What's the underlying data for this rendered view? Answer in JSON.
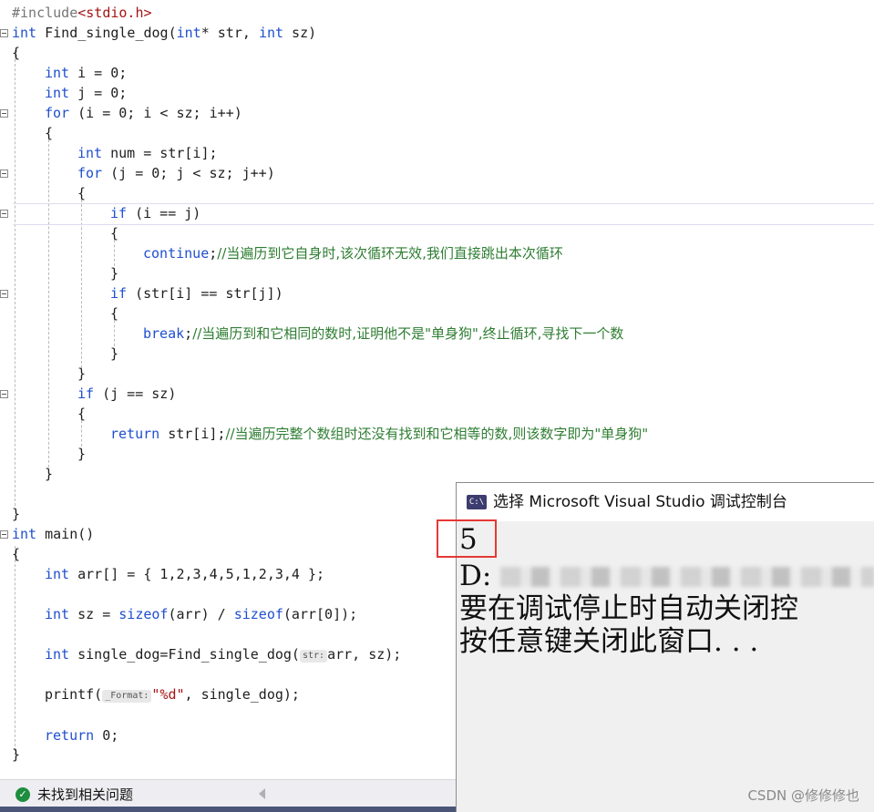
{
  "code": {
    "include_directive": "#include",
    "include_header": "<stdio.h>",
    "kw_int": "int",
    "kw_for": "for",
    "kw_if": "if",
    "kw_continue": "continue",
    "kw_break": "break",
    "kw_return": "return",
    "kw_sizeof": "sizeof",
    "l2_rest": " Find_single_dog(",
    "l2_rest2": "* str, ",
    "l2_rest3": " sz)",
    "brace_open": "{",
    "brace_close": "}",
    "l4_rest": " i = 0;",
    "l5_rest": " j = 0;",
    "l6_rest": " (i = 0; i < sz; i++)",
    "l8_rest": " num = str[i];",
    "l9_rest": " (j = 0; j < sz; j++)",
    "l11_rest": " (i == j)",
    "l13_comment": "//当遍历到它自身时,该次循环无效,我们直接跳出本次循环",
    "l15_rest": " (str[i] == str[j])",
    "l17_comment": "//当遍历到和它相同的数时,证明他不是\"单身狗\",终止循环,寻找下一个数",
    "l20_rest": " (j == sz)",
    "l22_rest": " str[i];",
    "l22_comment": "//当遍历完整个数组时还没有找到和它相等的数,则该数字即为\"单身狗\"",
    "main_rest": " main()",
    "arr_rest": " arr[] = { 1,2,3,4,5,1,2,3,4 };",
    "sz_rest": " sz = ",
    "sz_rest2": "(arr) / ",
    "sz_rest3": "(arr[0]);",
    "sd_rest": " single_dog=Find_single_dog(",
    "sd_hint": "str:",
    "sd_rest2": "arr, sz);",
    "printf_open": "printf(",
    "printf_hint": "_Format:",
    "printf_str": "\"%d\"",
    "printf_rest": ", single_dog);",
    "return_rest": " 0;"
  },
  "console": {
    "title": "选择 Microsoft Visual Studio 调试控制台",
    "icon_label": "C:\\",
    "output_line1": "5",
    "output_line2": "D:",
    "output_line3": "要在调试停止时自动关闭控",
    "output_line4": "按任意键关闭此窗口. . ."
  },
  "status": {
    "text": "未找到相关问题",
    "check_glyph": "✓"
  },
  "watermark": "CSDN @修修修也",
  "colors": {
    "keyword": "#1f4fd0",
    "comment": "#2e7d32",
    "string": "#a31515",
    "highlight_box": "#e53935"
  }
}
